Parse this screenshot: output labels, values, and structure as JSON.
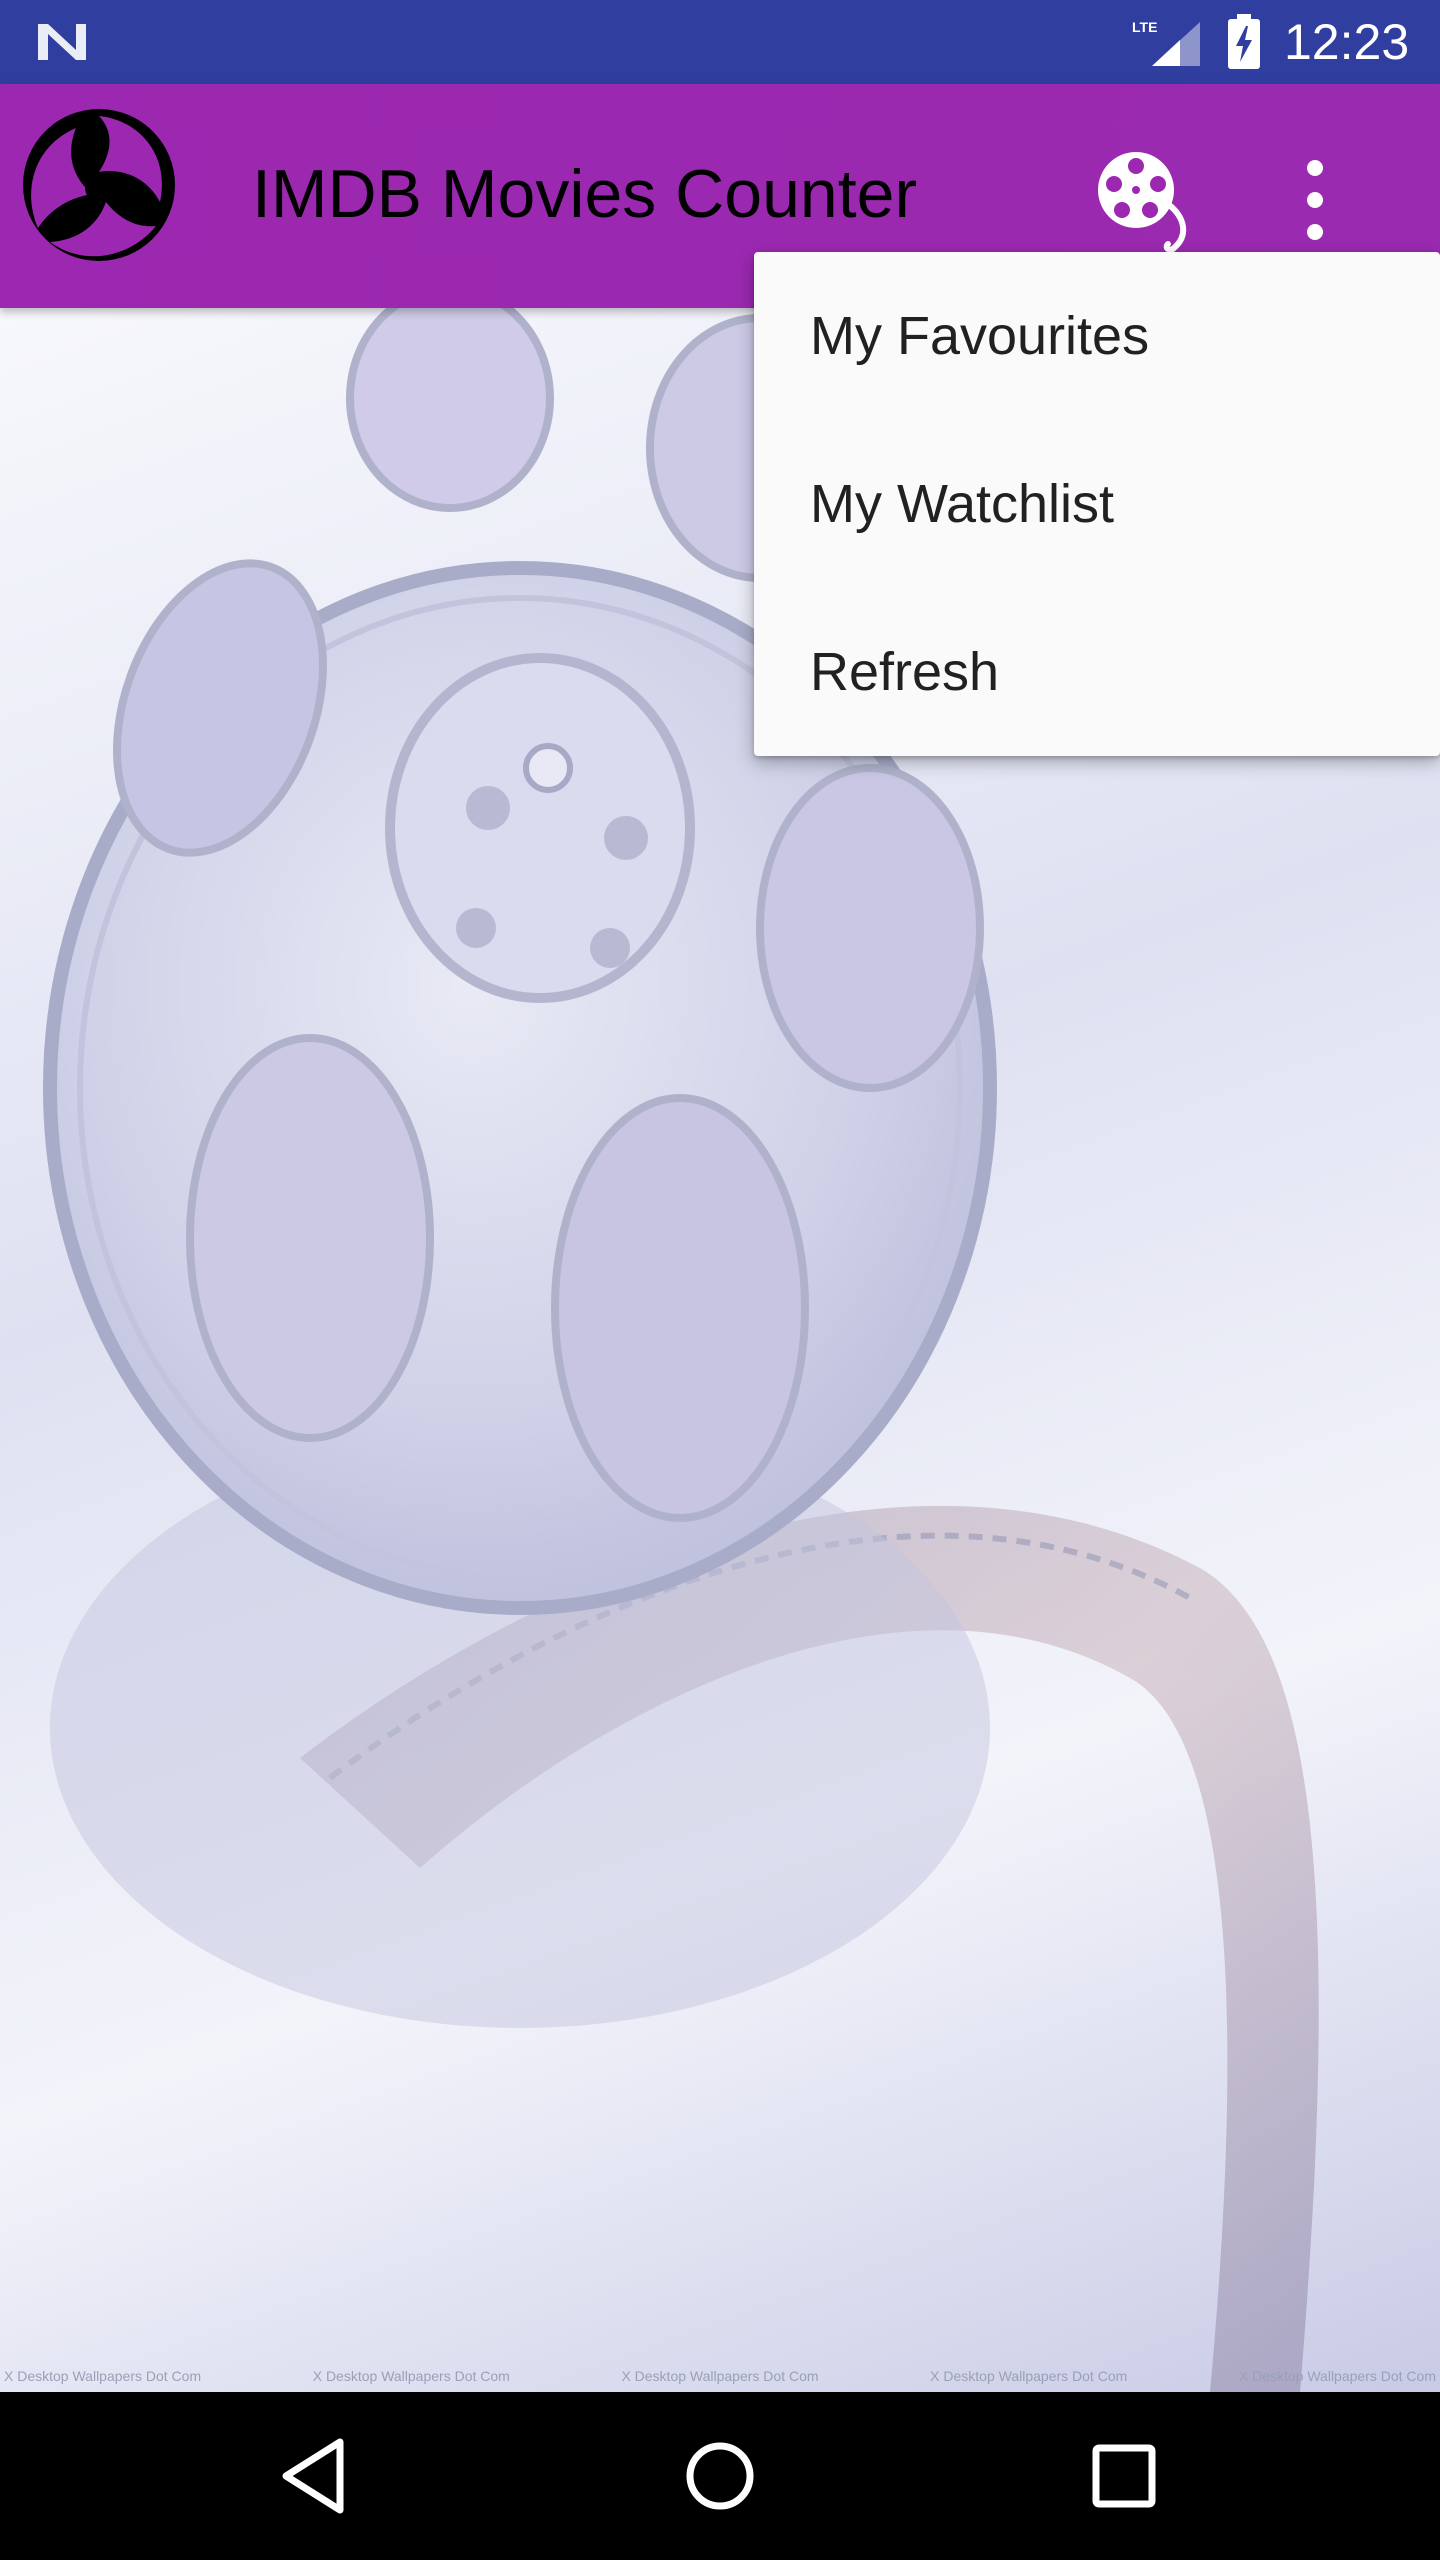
{
  "status_bar": {
    "time": "12:23",
    "network_label": "LTE",
    "icons": [
      "n-logo-icon",
      "lte-signal-icon",
      "battery-charging-icon"
    ]
  },
  "toolbar": {
    "title": "IMDB Movies Counter",
    "icons": [
      "app-logo-icon",
      "film-reel-icon",
      "more-vert-icon"
    ],
    "accent_color": "#9c27b0"
  },
  "overflow_menu": {
    "items": [
      {
        "label": "My Favourites"
      },
      {
        "label": "My Watchlist"
      },
      {
        "label": "Refresh"
      }
    ]
  },
  "background": {
    "watermark": "X Desktop Wallpapers Dot Com"
  },
  "nav_bar": {
    "icons": [
      "back-icon",
      "home-icon",
      "recents-icon"
    ]
  },
  "colors": {
    "status_bar": "#303f9f",
    "toolbar": "#9c27b0",
    "menu_bg": "#fafafa",
    "nav_bar": "#000000"
  }
}
